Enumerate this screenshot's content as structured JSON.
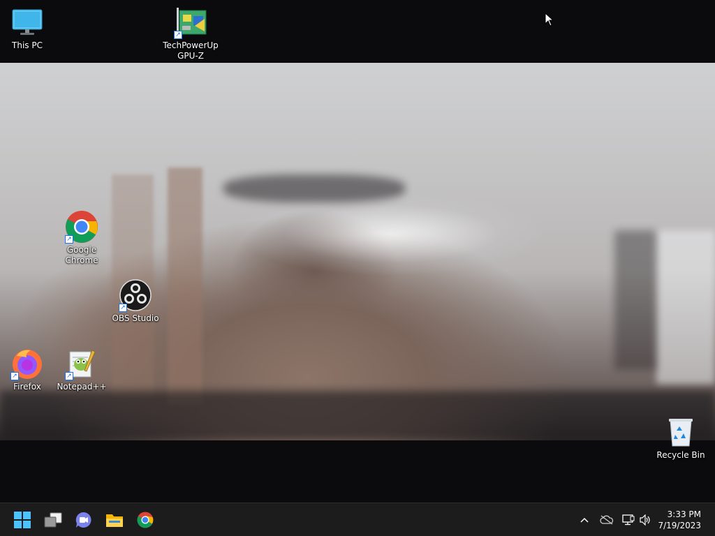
{
  "desktop": {
    "icons": [
      {
        "label": "This PC",
        "icon": "monitor-icon"
      },
      {
        "label": "TechPowerUp GPU-Z",
        "icon": "gpu-z-icon"
      },
      {
        "label": "Google Chrome",
        "icon": "chrome-icon"
      },
      {
        "label": "OBS Studio",
        "icon": "obs-icon"
      },
      {
        "label": "Firefox",
        "icon": "firefox-icon"
      },
      {
        "label": "Notepad++",
        "icon": "notepad-plus-plus-icon"
      },
      {
        "label": "Recycle Bin",
        "icon": "recycle-bin-icon"
      }
    ]
  },
  "taskbar": {
    "pinned": [
      {
        "name": "Start",
        "icon": "windows-start-icon"
      },
      {
        "name": "Task View",
        "icon": "task-view-icon"
      },
      {
        "name": "Chat",
        "icon": "chat-icon"
      },
      {
        "name": "File Explorer",
        "icon": "folder-icon"
      },
      {
        "name": "Google Chrome",
        "icon": "chrome-icon"
      }
    ],
    "tray": {
      "icons": [
        "chevron-up-icon",
        "onedrive-offline-icon",
        "network-icon",
        "volume-icon"
      ],
      "time": "3:33 PM",
      "date": "7/19/2023"
    }
  },
  "colors": {
    "desktop_background": "#0b0b0d",
    "taskbar": "#1c1c1c",
    "chrome_red": "#db4437",
    "chrome_yellow": "#f4b400",
    "chrome_green": "#0f9d58",
    "chrome_blue": "#4285f4",
    "windows_blue": "#4cc2ff"
  }
}
